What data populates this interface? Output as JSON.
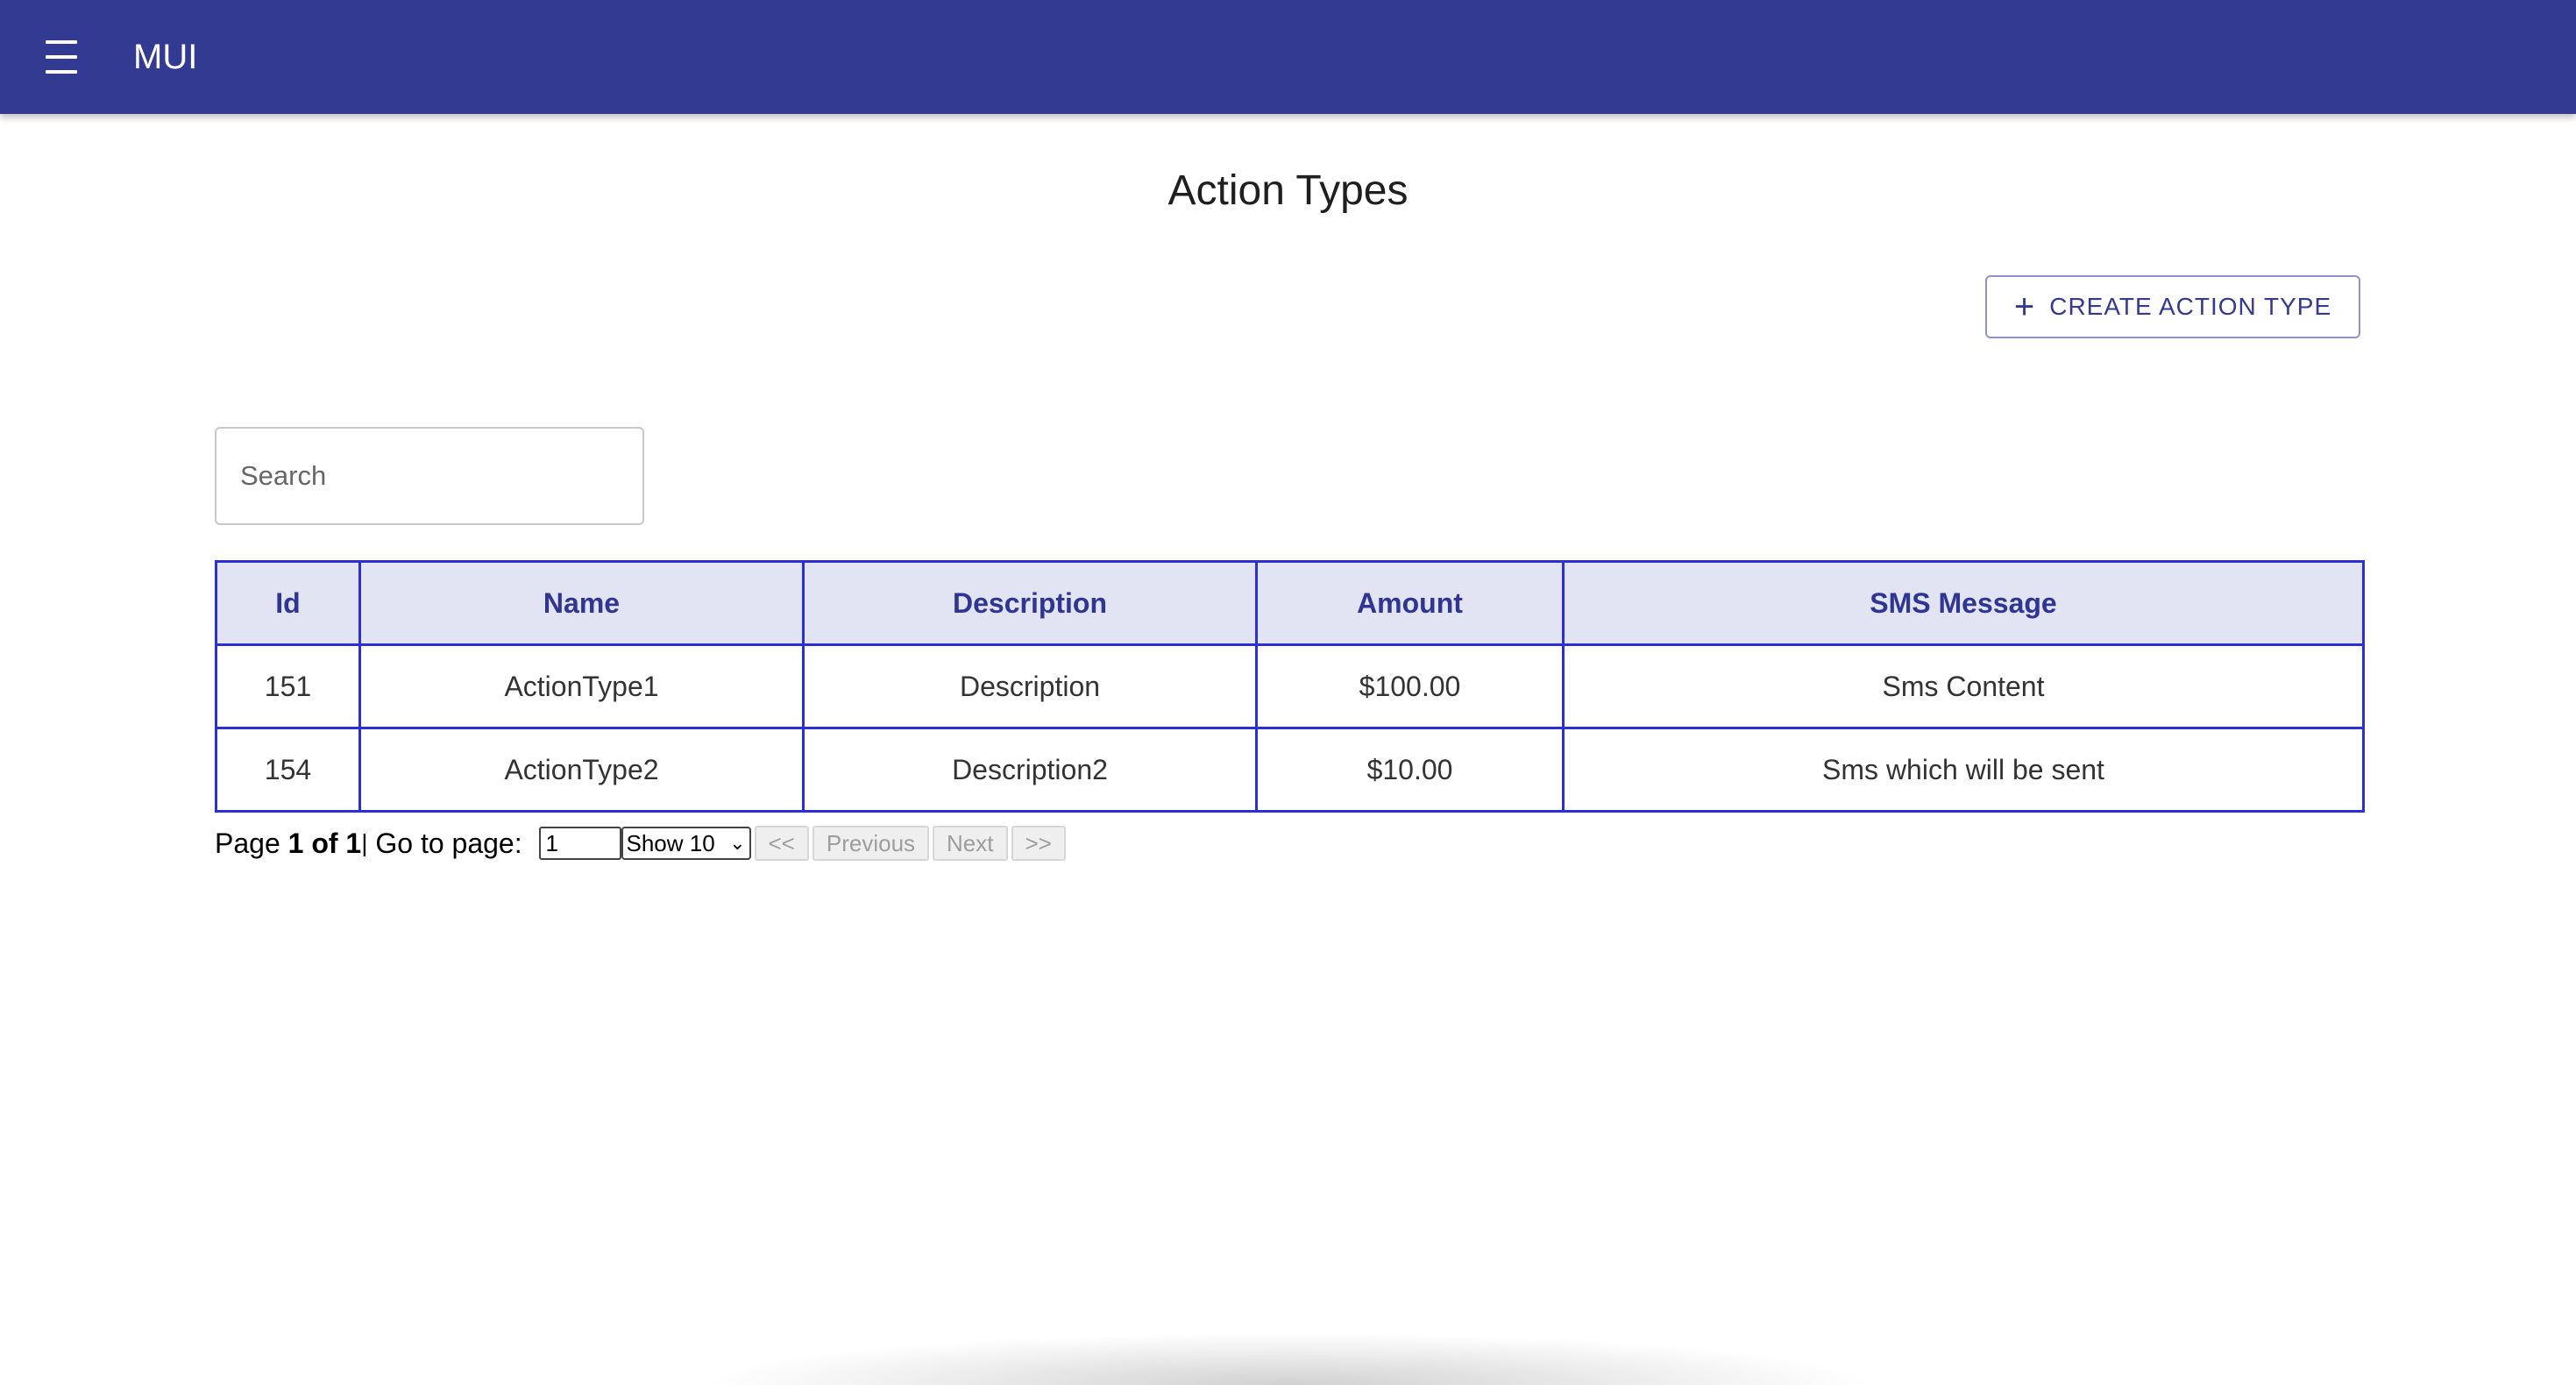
{
  "app_bar": {
    "title": "MUI",
    "menu_icon": "hamburger-menu-icon",
    "color": "#333a91"
  },
  "page": {
    "title": "Action Types",
    "create_button_label": "CREATE ACTION TYPE",
    "create_button_icon": "plus-icon"
  },
  "search": {
    "placeholder": "Search",
    "value": ""
  },
  "table": {
    "headers": [
      "Id",
      "Name",
      "Description",
      "Amount",
      "SMS Message"
    ],
    "rows": [
      {
        "id": "151",
        "name": "ActionType1",
        "description": "Description",
        "amount": "$100.00",
        "sms": "Sms Content"
      },
      {
        "id": "154",
        "name": "ActionType2",
        "description": "Description2",
        "amount": "$10.00",
        "sms": "Sms which will be sent"
      }
    ],
    "header_bg": "#e2e3f3",
    "border_color": "#2b2fd6"
  },
  "pagination": {
    "page_prefix": "Page ",
    "page_status": "1 of 1",
    "separator": "|",
    "goto_label": " Go to page: ",
    "goto_value": "1",
    "show_label": "Show 10",
    "first_label": "<<",
    "prev_label": "Previous",
    "next_label": "Next",
    "last_label": ">>"
  }
}
